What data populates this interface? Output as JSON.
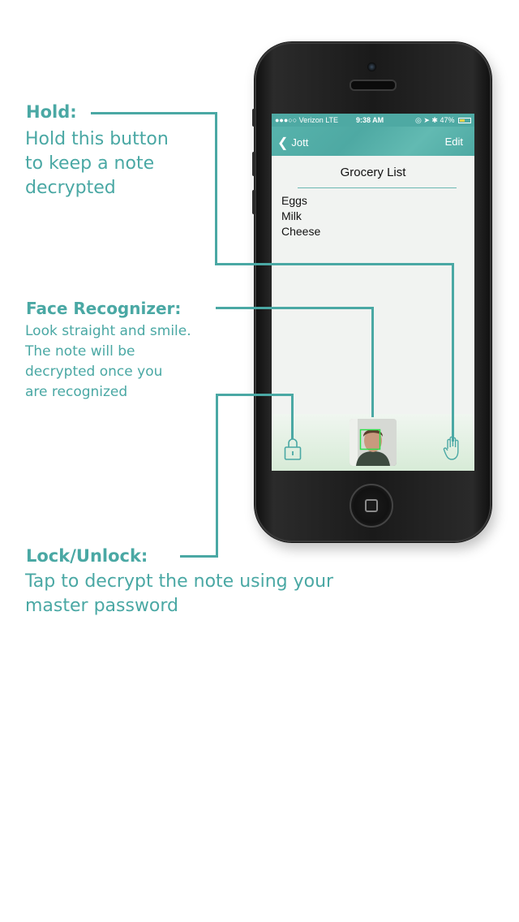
{
  "annotations": {
    "hold": {
      "title": "Hold:",
      "lines": [
        "Hold this button",
        "to keep a note",
        "decrypted"
      ]
    },
    "face": {
      "title": "Face Recognizer:",
      "lines": [
        "Look straight and smile.",
        "The note will be",
        "decrypted once you",
        "are recognized"
      ]
    },
    "lock": {
      "title": "Lock/Unlock:",
      "lines": [
        "Tap to decrypt the note using your",
        "master password"
      ]
    }
  },
  "phone": {
    "status_bar": {
      "carrier": "●●●○○ Verizon  LTE",
      "time": "9:38 AM",
      "battery_text": "47%"
    },
    "nav": {
      "back_label": "Jott",
      "edit_label": "Edit"
    },
    "note": {
      "title": "Grocery List",
      "items": [
        "Eggs",
        "Milk",
        "Cheese"
      ]
    },
    "toolbar": {
      "lock_icon": "lock-icon",
      "face_icon": "face-recognizer-camera",
      "hold_icon": "hand-icon"
    }
  },
  "colors": {
    "accent": "#4aa8a4",
    "nav_bar": "#4ea9a3"
  }
}
